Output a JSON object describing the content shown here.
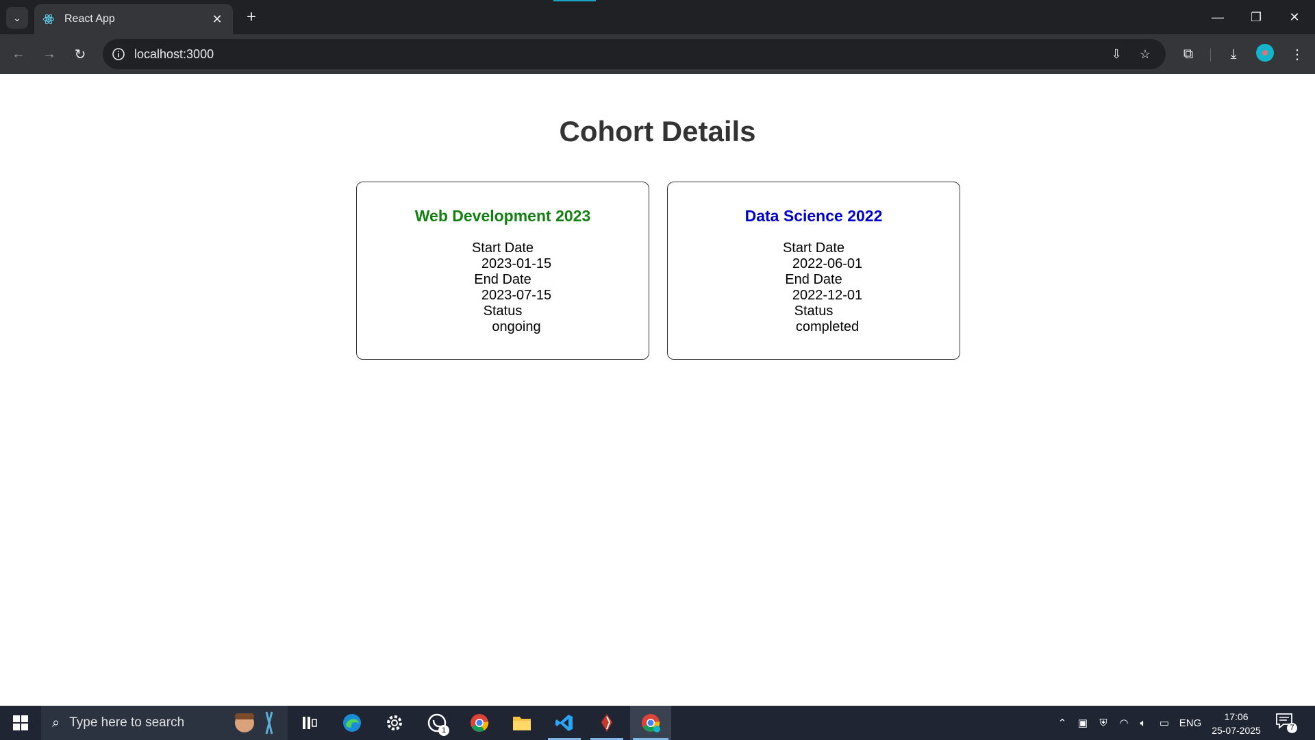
{
  "browser": {
    "tab_title": "React App",
    "url": "localhost:3000"
  },
  "page": {
    "title": "Cohort Details",
    "cohorts": [
      {
        "name": "Web Development 2023",
        "name_color": "#118010",
        "start_label": "Start Date",
        "start": "2023-01-15",
        "end_label": "End Date",
        "end": "2023-07-15",
        "status_label": "Status",
        "status": "ongoing"
      },
      {
        "name": "Data Science 2022",
        "name_color": "#0000cd",
        "start_label": "Start Date",
        "start": "2022-06-01",
        "end_label": "End Date",
        "end": "2022-12-01",
        "status_label": "Status",
        "status": "completed"
      }
    ]
  },
  "taskbar": {
    "search_placeholder": "Type here to search",
    "whatsapp_badge": "1",
    "language": "ENG",
    "time": "17:06",
    "date": "25-07-2025",
    "notifications": "7"
  },
  "icons": [
    "tab-search-icon",
    "react-icon",
    "close-icon",
    "plus-icon",
    "minimize-icon",
    "restore-icon",
    "back-icon",
    "forward-icon",
    "reload-icon",
    "info-icon",
    "install-icon",
    "star-icon",
    "extensions-icon",
    "download-icon",
    "menu-icon",
    "windows-icon",
    "search-icon"
  ]
}
